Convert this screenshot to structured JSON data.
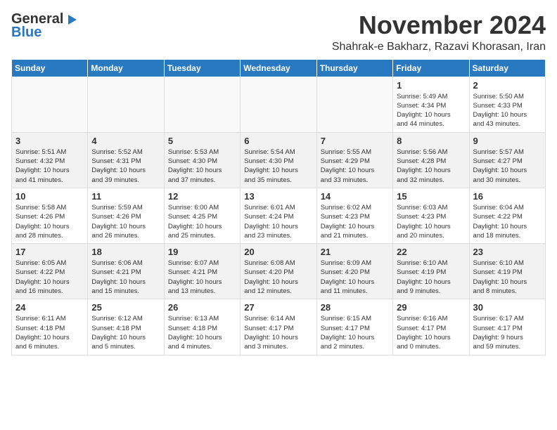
{
  "header": {
    "logo_line1": "General",
    "logo_line2": "Blue",
    "month": "November 2024",
    "location": "Shahrak-e Bakharz, Razavi Khorasan, Iran"
  },
  "days_of_week": [
    "Sunday",
    "Monday",
    "Tuesday",
    "Wednesday",
    "Thursday",
    "Friday",
    "Saturday"
  ],
  "weeks": [
    [
      {
        "day": "",
        "info": ""
      },
      {
        "day": "",
        "info": ""
      },
      {
        "day": "",
        "info": ""
      },
      {
        "day": "",
        "info": ""
      },
      {
        "day": "",
        "info": ""
      },
      {
        "day": "1",
        "info": "Sunrise: 5:49 AM\nSunset: 4:34 PM\nDaylight: 10 hours\nand 44 minutes."
      },
      {
        "day": "2",
        "info": "Sunrise: 5:50 AM\nSunset: 4:33 PM\nDaylight: 10 hours\nand 43 minutes."
      }
    ],
    [
      {
        "day": "3",
        "info": "Sunrise: 5:51 AM\nSunset: 4:32 PM\nDaylight: 10 hours\nand 41 minutes."
      },
      {
        "day": "4",
        "info": "Sunrise: 5:52 AM\nSunset: 4:31 PM\nDaylight: 10 hours\nand 39 minutes."
      },
      {
        "day": "5",
        "info": "Sunrise: 5:53 AM\nSunset: 4:30 PM\nDaylight: 10 hours\nand 37 minutes."
      },
      {
        "day": "6",
        "info": "Sunrise: 5:54 AM\nSunset: 4:30 PM\nDaylight: 10 hours\nand 35 minutes."
      },
      {
        "day": "7",
        "info": "Sunrise: 5:55 AM\nSunset: 4:29 PM\nDaylight: 10 hours\nand 33 minutes."
      },
      {
        "day": "8",
        "info": "Sunrise: 5:56 AM\nSunset: 4:28 PM\nDaylight: 10 hours\nand 32 minutes."
      },
      {
        "day": "9",
        "info": "Sunrise: 5:57 AM\nSunset: 4:27 PM\nDaylight: 10 hours\nand 30 minutes."
      }
    ],
    [
      {
        "day": "10",
        "info": "Sunrise: 5:58 AM\nSunset: 4:26 PM\nDaylight: 10 hours\nand 28 minutes."
      },
      {
        "day": "11",
        "info": "Sunrise: 5:59 AM\nSunset: 4:26 PM\nDaylight: 10 hours\nand 26 minutes."
      },
      {
        "day": "12",
        "info": "Sunrise: 6:00 AM\nSunset: 4:25 PM\nDaylight: 10 hours\nand 25 minutes."
      },
      {
        "day": "13",
        "info": "Sunrise: 6:01 AM\nSunset: 4:24 PM\nDaylight: 10 hours\nand 23 minutes."
      },
      {
        "day": "14",
        "info": "Sunrise: 6:02 AM\nSunset: 4:23 PM\nDaylight: 10 hours\nand 21 minutes."
      },
      {
        "day": "15",
        "info": "Sunrise: 6:03 AM\nSunset: 4:23 PM\nDaylight: 10 hours\nand 20 minutes."
      },
      {
        "day": "16",
        "info": "Sunrise: 6:04 AM\nSunset: 4:22 PM\nDaylight: 10 hours\nand 18 minutes."
      }
    ],
    [
      {
        "day": "17",
        "info": "Sunrise: 6:05 AM\nSunset: 4:22 PM\nDaylight: 10 hours\nand 16 minutes."
      },
      {
        "day": "18",
        "info": "Sunrise: 6:06 AM\nSunset: 4:21 PM\nDaylight: 10 hours\nand 15 minutes."
      },
      {
        "day": "19",
        "info": "Sunrise: 6:07 AM\nSunset: 4:21 PM\nDaylight: 10 hours\nand 13 minutes."
      },
      {
        "day": "20",
        "info": "Sunrise: 6:08 AM\nSunset: 4:20 PM\nDaylight: 10 hours\nand 12 minutes."
      },
      {
        "day": "21",
        "info": "Sunrise: 6:09 AM\nSunset: 4:20 PM\nDaylight: 10 hours\nand 11 minutes."
      },
      {
        "day": "22",
        "info": "Sunrise: 6:10 AM\nSunset: 4:19 PM\nDaylight: 10 hours\nand 9 minutes."
      },
      {
        "day": "23",
        "info": "Sunrise: 6:10 AM\nSunset: 4:19 PM\nDaylight: 10 hours\nand 8 minutes."
      }
    ],
    [
      {
        "day": "24",
        "info": "Sunrise: 6:11 AM\nSunset: 4:18 PM\nDaylight: 10 hours\nand 6 minutes."
      },
      {
        "day": "25",
        "info": "Sunrise: 6:12 AM\nSunset: 4:18 PM\nDaylight: 10 hours\nand 5 minutes."
      },
      {
        "day": "26",
        "info": "Sunrise: 6:13 AM\nSunset: 4:18 PM\nDaylight: 10 hours\nand 4 minutes."
      },
      {
        "day": "27",
        "info": "Sunrise: 6:14 AM\nSunset: 4:17 PM\nDaylight: 10 hours\nand 3 minutes."
      },
      {
        "day": "28",
        "info": "Sunrise: 6:15 AM\nSunset: 4:17 PM\nDaylight: 10 hours\nand 2 minutes."
      },
      {
        "day": "29",
        "info": "Sunrise: 6:16 AM\nSunset: 4:17 PM\nDaylight: 10 hours\nand 0 minutes."
      },
      {
        "day": "30",
        "info": "Sunrise: 6:17 AM\nSunset: 4:17 PM\nDaylight: 9 hours\nand 59 minutes."
      }
    ]
  ]
}
